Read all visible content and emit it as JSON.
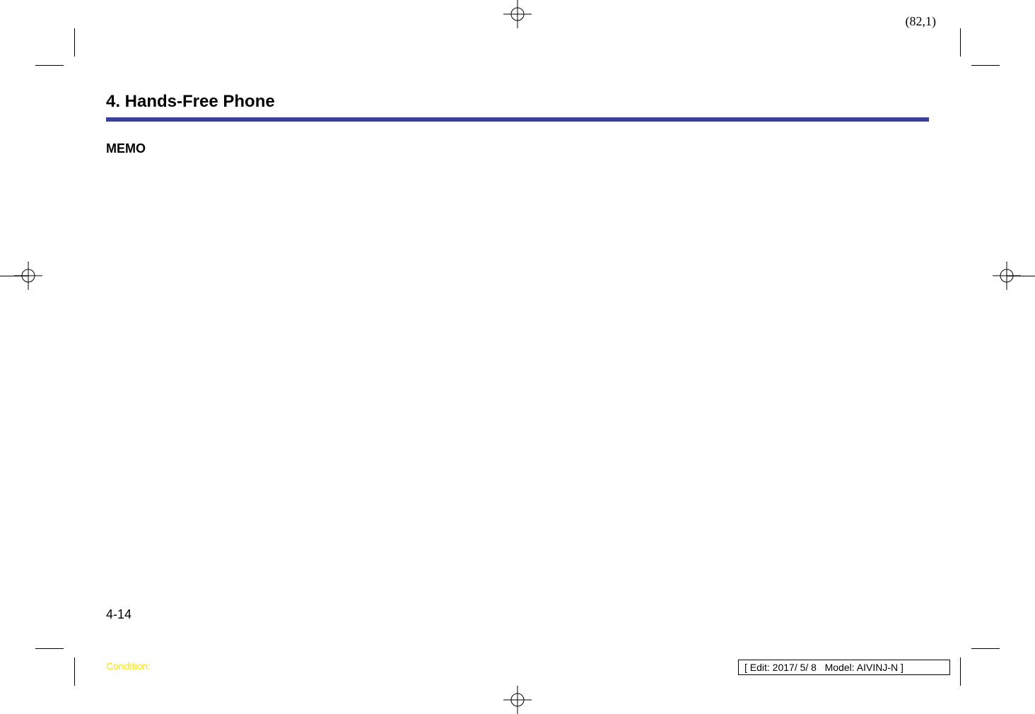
{
  "coord_label": "(82,1)",
  "section_title": "4. Hands-Free Phone",
  "memo_label": "MEMO",
  "page_number": "4-14",
  "condition_label": "Condition:",
  "edit_info": "[ Edit: 2017/ 5/ 8   Model: AIVINJ-N ]",
  "colors": {
    "rule": "#3a3f9b",
    "condition": "#ffe600"
  }
}
